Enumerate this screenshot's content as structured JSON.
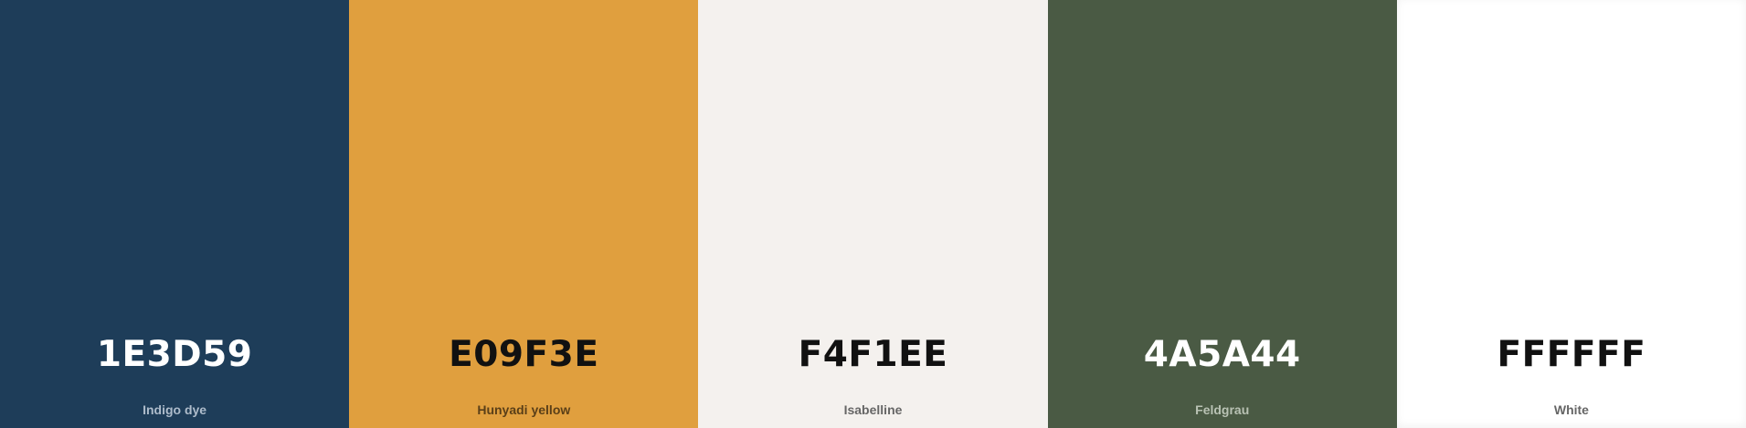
{
  "palette": {
    "swatches": [
      {
        "hex": "1E3D59",
        "name": "Indigo dye",
        "color": "#1E3D59",
        "hex_text_color": "#ffffff",
        "name_text_color": "#aebccb"
      },
      {
        "hex": "E09F3E",
        "name": "Hunyadi yellow",
        "color": "#E09F3E",
        "hex_text_color": "#111111",
        "name_text_color": "#5a3f18"
      },
      {
        "hex": "F4F1EE",
        "name": "Isabelline",
        "color": "#F4F1EE",
        "hex_text_color": "#111111",
        "name_text_color": "#666666"
      },
      {
        "hex": "4A5A44",
        "name": "Feldgrau",
        "color": "#4A5A44",
        "hex_text_color": "#ffffff",
        "name_text_color": "#b9c2b4"
      },
      {
        "hex": "FFFFFF",
        "name": "White",
        "color": "#FFFFFF",
        "hex_text_color": "#111111",
        "name_text_color": "#666666"
      }
    ]
  }
}
